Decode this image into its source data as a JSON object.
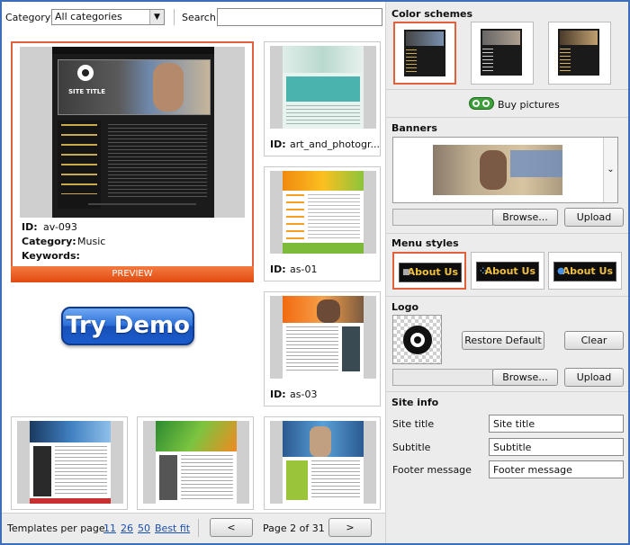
{
  "filter": {
    "category_label": "Category",
    "category_value": "All categories",
    "search_label": "Search",
    "search_value": ""
  },
  "featured": {
    "id_label": "ID:",
    "id_value": "av-093",
    "category_label": "Category:",
    "category_value": "Music",
    "keywords_label": "Keywords:",
    "keywords_value": "",
    "preview_label": "PREVIEW",
    "site_title_art": "SITE TITLE"
  },
  "try_demo_label": "Try Demo",
  "templates": [
    {
      "id_label": "ID:",
      "id": "art_and_photogr..."
    },
    {
      "id_label": "ID:",
      "id": "as-01"
    },
    {
      "id_label": "ID:",
      "id": "as-03"
    }
  ],
  "pagination": {
    "per_page_label": "Templates per page:",
    "options": [
      "11",
      "26",
      "50",
      "Best fit"
    ],
    "prev_label": "<",
    "page_text": "Page 2 of 31",
    "next_label": ">"
  },
  "panel": {
    "color_schemes_title": "Color schemes",
    "buy_pictures_label": "Buy pictures",
    "banners_title": "Banners",
    "browse_label": "Browse...",
    "upload_label": "Upload",
    "menu_styles_title": "Menu styles",
    "menu_style_label": "About Us",
    "logo_title": "Logo",
    "restore_default_label": "Restore Default",
    "clear_label": "Clear",
    "site_info_title": "Site info",
    "fields": [
      {
        "label": "Site title",
        "value": "Site title"
      },
      {
        "label": "Subtitle",
        "value": "Subtitle"
      },
      {
        "label": "Footer message",
        "value": "Footer message"
      }
    ]
  },
  "colors": {
    "accent": "#e0613b",
    "preview_bar": "#f05a1a",
    "demo_blue": "#1f5fd0",
    "link": "#1a4fb0",
    "frame": "#3c6fb8"
  }
}
